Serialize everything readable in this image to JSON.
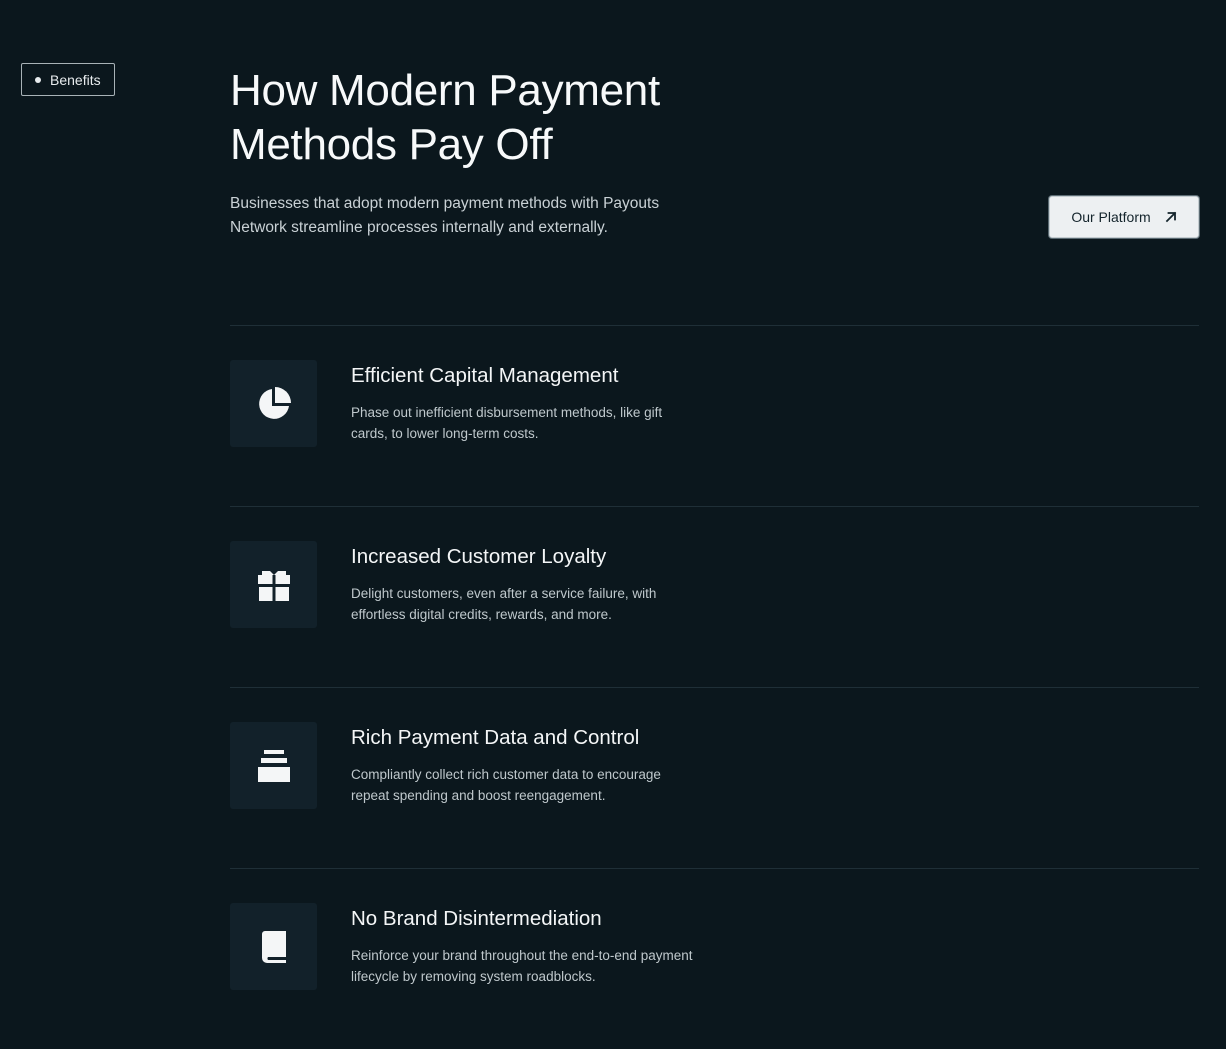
{
  "badge": {
    "label": "Benefits"
  },
  "header": {
    "title": "How Modern Payment Methods Pay Off",
    "description": "Businesses that adopt modern payment methods with Payouts Network streamline processes internally and externally."
  },
  "cta": {
    "label": "Our Platform",
    "icon": "arrow-up-right-icon"
  },
  "features": [
    {
      "icon": "pie-chart-icon",
      "title": "Efficient Capital Management",
      "description": "Phase out inefficient disbursement methods, like gift cards, to lower long-term costs."
    },
    {
      "icon": "gift-icon",
      "title": "Increased Customer Loyalty",
      "description": "Delight customers, even after a service failure, with effortless digital credits, rewards, and more."
    },
    {
      "icon": "archive-icon",
      "title": "Rich Payment Data and Control",
      "description": "Compliantly collect rich customer data to encourage repeat spending and boost reengagement."
    },
    {
      "icon": "book-icon",
      "title": "No Brand Disintermediation",
      "description": "Reinforce your brand throughout the end-to-end payment lifecycle by removing system roadblocks."
    }
  ],
  "colors": {
    "background": "#0b171d",
    "icon_tile": "#12212a",
    "divider": "#1f2f37",
    "button_bg": "#edf0f2",
    "button_text": "#14242c"
  }
}
